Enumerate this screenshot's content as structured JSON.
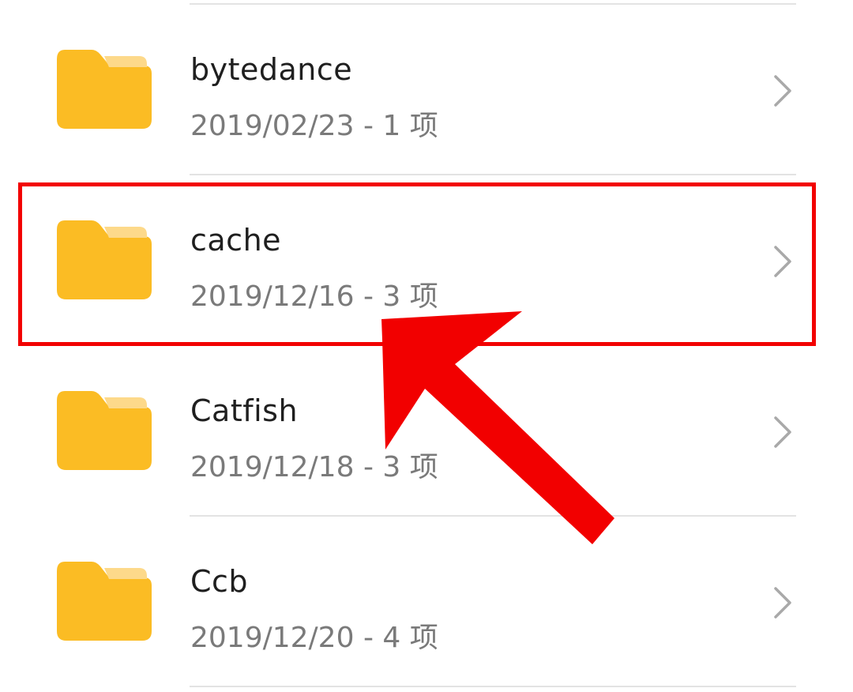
{
  "folders": [
    {
      "name": "bytedance",
      "date": "2019/02/23",
      "count": "1 项"
    },
    {
      "name": "cache",
      "date": "2019/12/16",
      "count": "3 项"
    },
    {
      "name": "Catfish",
      "date": "2019/12/18",
      "count": "3 项"
    },
    {
      "name": "Ccb",
      "date": "2019/12/20",
      "count": "4 项"
    }
  ],
  "separator": "-",
  "icons": {
    "folder": "folder-icon",
    "chevron": "chevron-right-icon"
  },
  "colors": {
    "folder_body": "#fbbc24",
    "folder_tab": "#fdd98a",
    "annotation": "#f20000",
    "name_text": "#1f1f1f",
    "meta_text": "#7a7a7a"
  },
  "annotation": {
    "highlighted_folder": "cache"
  }
}
